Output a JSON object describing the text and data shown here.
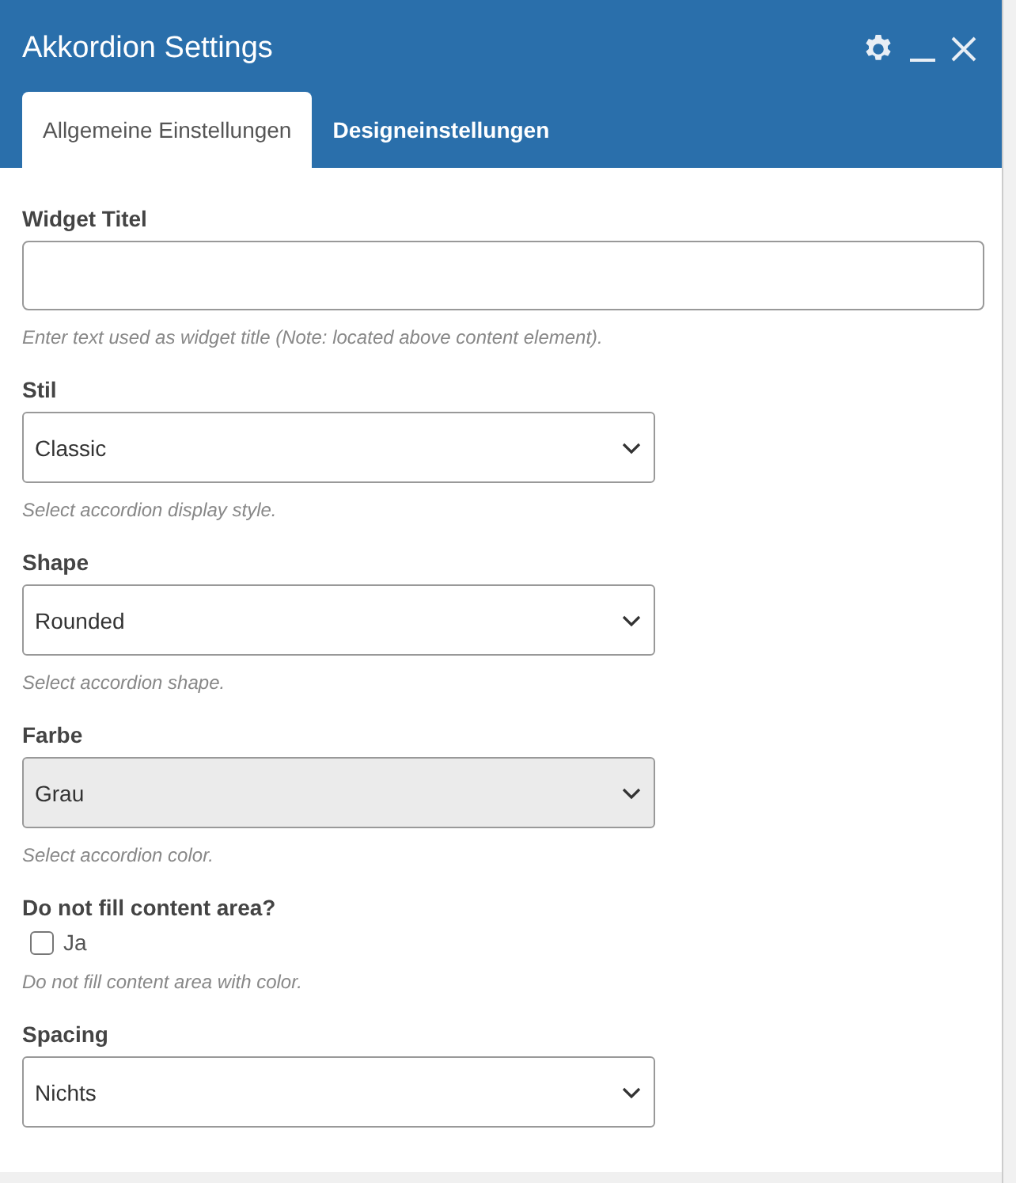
{
  "window": {
    "title": "Akkordion Settings"
  },
  "tabs": [
    {
      "label": "Allgemeine Einstellungen",
      "selected": true
    },
    {
      "label": "Designeinstellungen",
      "selected": false
    }
  ],
  "fields": [
    {
      "kind": "text",
      "label": "Widget Titel",
      "help": "Enter text used as widget title (Note: located above content element)."
    },
    {
      "kind": "select",
      "label": "Stil",
      "value": "Classic",
      "help": "Select accordion display style."
    },
    {
      "kind": "select",
      "label": "Shape",
      "value": "Rounded",
      "help": "Select accordion shape."
    },
    {
      "kind": "color-select",
      "label": "Farbe",
      "value": "Grau",
      "color": "#ebebeb",
      "help": "Select accordion color."
    },
    {
      "kind": "checkbox",
      "label": "Do not fill content area?",
      "option": "Ja",
      "checked": false,
      "help": "Do not fill content area with color."
    },
    {
      "kind": "select",
      "label": "Spacing",
      "value": "Nichts"
    }
  ]
}
